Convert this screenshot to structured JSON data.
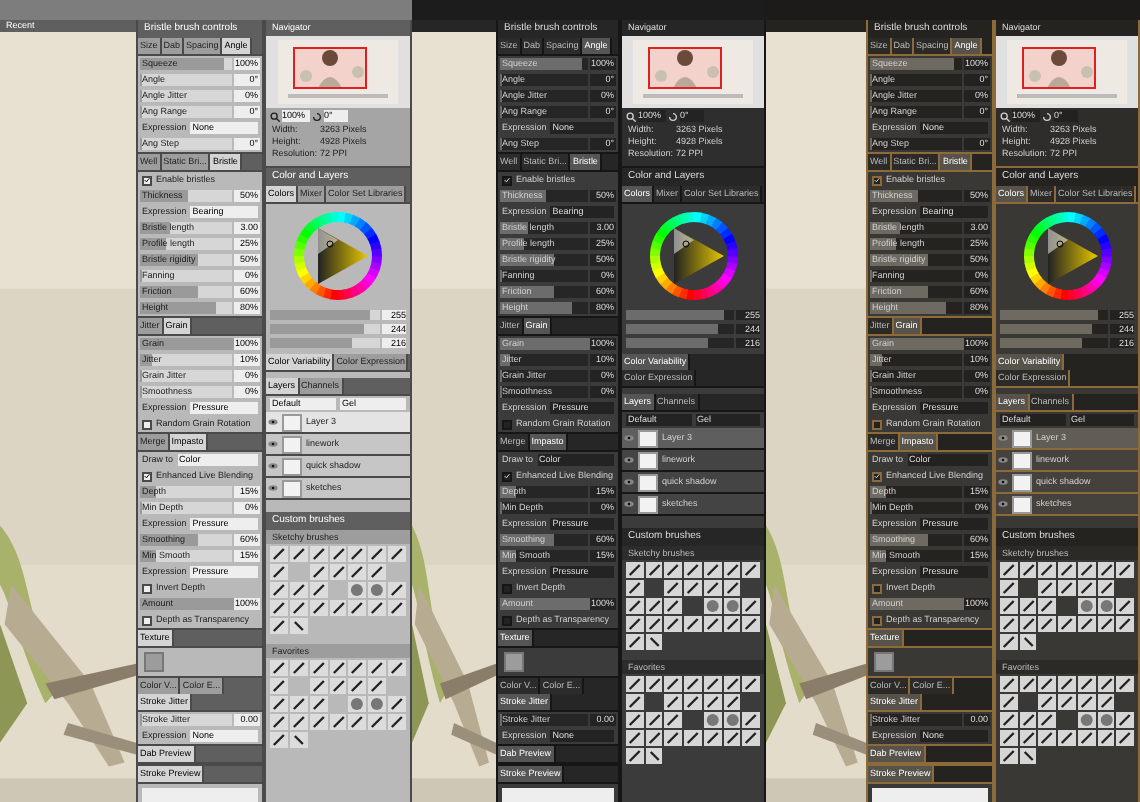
{
  "columns": [
    {
      "kind": "light",
      "canvas": {
        "title": "Recent"
      },
      "brush_panel": {
        "title": "Bristle brush controls",
        "sections": [
          {
            "tabs": [
              {
                "label": "Size",
                "selected": false
              },
              {
                "label": "Dab",
                "selected": false
              },
              {
                "label": "Spacing",
                "selected": false
              },
              {
                "label": "Angle",
                "selected": true
              }
            ],
            "rows": [
              {
                "kind": "slider",
                "label": "Squeeze",
                "reading": "100%",
                "level": 0.9
              },
              {
                "kind": "slider",
                "label": "Angle",
                "reading": "0°",
                "level": 0
              },
              {
                "kind": "slider",
                "label": "Angle Jitter",
                "reading": "0%",
                "level": 0
              },
              {
                "kind": "slider",
                "label": "Ang Range",
                "reading": "0°",
                "level": 0
              },
              {
                "kind": "select",
                "label": "Expression",
                "value": "None"
              },
              {
                "kind": "slider",
                "label": "Ang Step",
                "reading": "0°",
                "level": 0
              }
            ]
          },
          {
            "tabs": [
              {
                "label": "Well",
                "selected": false
              },
              {
                "label": "Static Bri...",
                "selected": false
              },
              {
                "label": "Bristle",
                "selected": true
              }
            ],
            "rows": [
              {
                "kind": "check",
                "label": "Enable bristles",
                "checked": true
              },
              {
                "kind": "slider",
                "label": "Thickness",
                "reading": "50%",
                "level": 0.5
              },
              {
                "kind": "select",
                "label": "Expression",
                "value": "Bearing"
              },
              {
                "kind": "slider",
                "label": "Bristle length",
                "reading": "3.00",
                "level": 0.3
              },
              {
                "kind": "slider",
                "label": "Profile length",
                "reading": "25%",
                "level": 0.25
              },
              {
                "kind": "slider",
                "label": "Bristle rigidity",
                "reading": "50%",
                "level": 0.6
              },
              {
                "kind": "slider",
                "label": "Fanning",
                "reading": "0%",
                "level": 0
              },
              {
                "kind": "slider",
                "label": "Friction",
                "reading": "60%",
                "level": 0.6
              },
              {
                "kind": "slider",
                "label": "Height",
                "reading": "80%",
                "level": 0.8
              }
            ]
          },
          {
            "tabs": [
              {
                "label": "Jitter",
                "selected": false
              },
              {
                "label": "Grain",
                "selected": true
              }
            ],
            "rows": [
              {
                "kind": "slider",
                "label": "Grain",
                "reading": "100%",
                "level": 1
              },
              {
                "kind": "slider",
                "label": "Jitter",
                "reading": "10%",
                "level": 0.1
              },
              {
                "kind": "slider",
                "label": "Grain Jitter",
                "reading": "0%",
                "level": 0
              },
              {
                "kind": "slider",
                "label": "Smoothness",
                "reading": "0%",
                "level": 0
              },
              {
                "kind": "select",
                "label": "Expression",
                "value": "Pressure"
              },
              {
                "kind": "check",
                "label": "Random Grain Rotation",
                "checked": false
              }
            ]
          },
          {
            "tabs": [
              {
                "label": "Merge",
                "selected": false
              },
              {
                "label": "Impasto",
                "selected": true
              }
            ],
            "rows": [
              {
                "kind": "select",
                "label": "Draw to",
                "value": "Color"
              },
              {
                "kind": "check",
                "label": "Enhanced Live Blending",
                "checked": true
              },
              {
                "kind": "slider",
                "label": "Depth",
                "reading": "15%",
                "level": 0.15
              },
              {
                "kind": "slider",
                "label": "Min Depth",
                "reading": "0%",
                "level": 0
              },
              {
                "kind": "select",
                "label": "Expression",
                "value": "Pressure"
              },
              {
                "kind": "slider",
                "label": "Smoothing",
                "reading": "60%",
                "level": 0.6
              },
              {
                "kind": "slider",
                "label": "Min Smooth",
                "reading": "15%",
                "level": 0.15
              },
              {
                "kind": "select",
                "label": "Expression",
                "value": "Pressure"
              },
              {
                "kind": "check",
                "label": "Invert Depth",
                "checked": false
              },
              {
                "kind": "slider",
                "label": "Amount",
                "reading": "100%",
                "level": 1
              },
              {
                "kind": "check",
                "label": "Depth as Transparency",
                "checked": false
              }
            ]
          },
          {
            "tabs": [
              {
                "label": "Texture",
                "selected": true
              }
            ],
            "rows": [
              {
                "kind": "swatch"
              }
            ]
          },
          {
            "tabs": [
              {
                "label": "Color V...",
                "selected": false
              },
              {
                "label": "Color E...",
                "selected": false
              },
              {
                "label": "Stroke Jitter",
                "selected": true
              }
            ],
            "rows": [
              {
                "kind": "slider",
                "label": "Stroke Jitter",
                "reading": "0.00",
                "level": 0
              },
              {
                "kind": "select",
                "label": "Expression",
                "value": "None"
              }
            ]
          },
          {
            "tabs": [
              {
                "label": "Dab Preview",
                "selected": true
              }
            ]
          },
          {
            "tabs": [
              {
                "label": "Stroke Preview",
                "selected": true
              }
            ],
            "rows": [
              {
                "kind": "preview"
              }
            ]
          }
        ]
      },
      "right_panel": {
        "navigator": {
          "title": "Navigator",
          "zoom": "100%",
          "angle": "0°",
          "info": [
            {
              "label": "Width:",
              "value": "3263 Pixels"
            },
            {
              "label": "Height:",
              "value": "4928 Pixels"
            },
            {
              "label": "Resolution:",
              "value": "72 PPI"
            }
          ]
        },
        "color": {
          "title": "Color and Layers",
          "tabs": [
            {
              "label": "Colors",
              "selected": true
            },
            {
              "label": "Mixer",
              "selected": false
            },
            {
              "label": "Color Set Libraries",
              "selected": false
            }
          ],
          "sliders": [
            {
              "reading": "255",
              "level": 0.9
            },
            {
              "reading": "244",
              "level": 0.85
            },
            {
              "reading": "216",
              "level": 0.75
            }
          ],
          "subtabs": [
            {
              "label": "Color Variability",
              "selected": true
            },
            {
              "label": "Color Expression",
              "selected": false
            }
          ]
        },
        "layers": {
          "tabs": [
            {
              "label": "Layers",
              "selected": true
            },
            {
              "label": "Channels",
              "selected": false
            }
          ],
          "blend": "Default",
          "method": "Gel",
          "items": [
            {
              "name": "Layer 3",
              "selected": true
            },
            {
              "name": "linework",
              "selected": false
            },
            {
              "name": "quick shadow",
              "selected": false
            },
            {
              "name": "sketches",
              "selected": false
            }
          ]
        },
        "brushes": {
          "title": "Custom brushes",
          "groups": [
            {
              "title": "Sketchy brushes"
            },
            {
              "title": "Favorites"
            }
          ]
        }
      }
    },
    {
      "kind": "dark",
      "brush_panel": {
        "title": "Bristle brush controls",
        "sections": [
          {
            "tabs": [
              {
                "label": "Size",
                "selected": false
              },
              {
                "label": "Dab",
                "selected": false
              },
              {
                "label": "Spacing",
                "selected": false
              },
              {
                "label": "Angle",
                "selected": true
              }
            ],
            "rows": [
              {
                "kind": "slider",
                "label": "Squeeze",
                "reading": "100%",
                "level": 0.9
              },
              {
                "kind": "slider",
                "label": "Angle",
                "reading": "0°",
                "level": 0
              },
              {
                "kind": "slider",
                "label": "Angle Jitter",
                "reading": "0%",
                "level": 0
              },
              {
                "kind": "slider",
                "label": "Ang Range",
                "reading": "0°",
                "level": 0
              },
              {
                "kind": "select",
                "label": "Expression",
                "value": "None"
              },
              {
                "kind": "slider",
                "label": "Ang Step",
                "reading": "0°",
                "level": 0
              }
            ]
          },
          {
            "tabs": [
              {
                "label": "Well",
                "selected": false
              },
              {
                "label": "Static Bri...",
                "selected": false
              },
              {
                "label": "Bristle",
                "selected": true
              }
            ],
            "rows": [
              {
                "kind": "check",
                "label": "Enable bristles",
                "checked": true
              },
              {
                "kind": "slider",
                "label": "Thickness",
                "reading": "50%",
                "level": 0.5
              },
              {
                "kind": "select",
                "label": "Expression",
                "value": "Bearing"
              },
              {
                "kind": "slider",
                "label": "Bristle length",
                "reading": "3.00",
                "level": 0.3
              },
              {
                "kind": "slider",
                "label": "Profile length",
                "reading": "25%",
                "level": 0.25
              },
              {
                "kind": "slider",
                "label": "Bristle rigidity",
                "reading": "50%",
                "level": 0.6
              },
              {
                "kind": "slider",
                "label": "Fanning",
                "reading": "0%",
                "level": 0
              },
              {
                "kind": "slider",
                "label": "Friction",
                "reading": "60%",
                "level": 0.6
              },
              {
                "kind": "slider",
                "label": "Height",
                "reading": "80%",
                "level": 0.8
              }
            ]
          },
          {
            "tabs": [
              {
                "label": "Jitter",
                "selected": false
              },
              {
                "label": "Grain",
                "selected": true
              }
            ],
            "rows": [
              {
                "kind": "slider",
                "label": "Grain",
                "reading": "100%",
                "level": 1
              },
              {
                "kind": "slider",
                "label": "Jitter",
                "reading": "10%",
                "level": 0.1
              },
              {
                "kind": "slider",
                "label": "Grain Jitter",
                "reading": "0%",
                "level": 0
              },
              {
                "kind": "slider",
                "label": "Smoothness",
                "reading": "0%",
                "level": 0
              },
              {
                "kind": "select",
                "label": "Expression",
                "value": "Pressure"
              },
              {
                "kind": "check",
                "label": "Random Grain Rotation",
                "checked": false
              }
            ]
          },
          {
            "tabs": [
              {
                "label": "Merge",
                "selected": false
              },
              {
                "label": "Impasto",
                "selected": true
              }
            ],
            "rows": [
              {
                "kind": "select",
                "label": "Draw to",
                "value": "Color"
              },
              {
                "kind": "check",
                "label": "Enhanced Live Blending",
                "checked": true
              },
              {
                "kind": "slider",
                "label": "Depth",
                "reading": "15%",
                "level": 0.15
              },
              {
                "kind": "slider",
                "label": "Min Depth",
                "reading": "0%",
                "level": 0
              },
              {
                "kind": "select",
                "label": "Expression",
                "value": "Pressure"
              },
              {
                "kind": "slider",
                "label": "Smoothing",
                "reading": "60%",
                "level": 0.6
              },
              {
                "kind": "slider",
                "label": "Min Smooth",
                "reading": "15%",
                "level": 0.15
              },
              {
                "kind": "select",
                "label": "Expression",
                "value": "Pressure"
              },
              {
                "kind": "check",
                "label": "Invert Depth",
                "checked": false
              },
              {
                "kind": "slider",
                "label": "Amount",
                "reading": "100%",
                "level": 1
              },
              {
                "kind": "check",
                "label": "Depth as Transparency",
                "checked": false
              }
            ]
          },
          {
            "tabs": [
              {
                "label": "Texture",
                "selected": true
              }
            ],
            "rows": [
              {
                "kind": "swatch"
              }
            ]
          },
          {
            "tabs": [
              {
                "label": "Color V...",
                "selected": false
              },
              {
                "label": "Color E...",
                "selected": false
              },
              {
                "label": "Stroke Jitter",
                "selected": true
              }
            ],
            "rows": [
              {
                "kind": "slider",
                "label": "Stroke Jitter",
                "reading": "0.00",
                "level": 0
              },
              {
                "kind": "select",
                "label": "Expression",
                "value": "None"
              }
            ]
          },
          {
            "tabs": [
              {
                "label": "Dab Preview",
                "selected": true
              }
            ]
          },
          {
            "tabs": [
              {
                "label": "Stroke Preview",
                "selected": true
              }
            ],
            "rows": [
              {
                "kind": "preview"
              }
            ]
          }
        ]
      },
      "right_panel": {
        "navigator": {
          "title": "Navigator",
          "zoom": "100%",
          "angle": "0°",
          "info": [
            {
              "label": "Width:",
              "value": "3263 Pixels"
            },
            {
              "label": "Height:",
              "value": "4928 Pixels"
            },
            {
              "label": "Resolution:",
              "value": "72 PPI"
            }
          ]
        },
        "color": {
          "title": "Color and Layers",
          "tabs": [
            {
              "label": "Colors",
              "selected": true
            },
            {
              "label": "Mixer",
              "selected": false
            },
            {
              "label": "Color Set Libraries",
              "selected": false
            }
          ],
          "sliders": [
            {
              "reading": "255",
              "level": 0.9
            },
            {
              "reading": "244",
              "level": 0.85
            },
            {
              "reading": "216",
              "level": 0.75
            }
          ],
          "subtabs": [
            {
              "label": "Color Variability",
              "selected": true
            },
            {
              "label": "Color Expression",
              "selected": false
            }
          ]
        },
        "layers": {
          "tabs": [
            {
              "label": "Layers",
              "selected": true
            },
            {
              "label": "Channels",
              "selected": false
            }
          ],
          "blend": "Default",
          "method": "Gel",
          "items": [
            {
              "name": "Layer 3",
              "selected": true
            },
            {
              "name": "linework",
              "selected": false
            },
            {
              "name": "quick shadow",
              "selected": false
            },
            {
              "name": "sketches",
              "selected": false
            }
          ]
        },
        "brushes": {
          "title": "Custom brushes",
          "groups": [
            {
              "title": "Sketchy brushes"
            },
            {
              "title": "Favorites"
            }
          ]
        }
      }
    },
    {
      "kind": "amber",
      "brush_panel": {
        "title": "Bristle brush controls",
        "sections": [
          {
            "tabs": [
              {
                "label": "Size",
                "selected": false
              },
              {
                "label": "Dab",
                "selected": false
              },
              {
                "label": "Spacing",
                "selected": false
              },
              {
                "label": "Angle",
                "selected": true
              }
            ],
            "rows": [
              {
                "kind": "slider",
                "label": "Squeeze",
                "reading": "100%",
                "level": 0.9
              },
              {
                "kind": "slider",
                "label": "Angle",
                "reading": "0°",
                "level": 0
              },
              {
                "kind": "slider",
                "label": "Angle Jitter",
                "reading": "0%",
                "level": 0
              },
              {
                "kind": "slider",
                "label": "Ang Range",
                "reading": "0°",
                "level": 0
              },
              {
                "kind": "select",
                "label": "Expression",
                "value": "None"
              },
              {
                "kind": "slider",
                "label": "Ang Step",
                "reading": "0°",
                "level": 0
              }
            ]
          },
          {
            "tabs": [
              {
                "label": "Well",
                "selected": false
              },
              {
                "label": "Static Bri...",
                "selected": false
              },
              {
                "label": "Bristle",
                "selected": true
              }
            ],
            "rows": [
              {
                "kind": "check",
                "label": "Enable bristles",
                "checked": true
              },
              {
                "kind": "slider",
                "label": "Thickness",
                "reading": "50%",
                "level": 0.5
              },
              {
                "kind": "select",
                "label": "Expression",
                "value": "Bearing"
              },
              {
                "kind": "slider",
                "label": "Bristle length",
                "reading": "3.00",
                "level": 0.3
              },
              {
                "kind": "slider",
                "label": "Profile length",
                "reading": "25%",
                "level": 0.25
              },
              {
                "kind": "slider",
                "label": "Bristle rigidity",
                "reading": "50%",
                "level": 0.6
              },
              {
                "kind": "slider",
                "label": "Fanning",
                "reading": "0%",
                "level": 0
              },
              {
                "kind": "slider",
                "label": "Friction",
                "reading": "60%",
                "level": 0.6
              },
              {
                "kind": "slider",
                "label": "Height",
                "reading": "80%",
                "level": 0.8
              }
            ]
          },
          {
            "tabs": [
              {
                "label": "Jitter",
                "selected": false
              },
              {
                "label": "Grain",
                "selected": true
              }
            ],
            "rows": [
              {
                "kind": "slider",
                "label": "Grain",
                "reading": "100%",
                "level": 1
              },
              {
                "kind": "slider",
                "label": "Jitter",
                "reading": "10%",
                "level": 0.1
              },
              {
                "kind": "slider",
                "label": "Grain Jitter",
                "reading": "0%",
                "level": 0
              },
              {
                "kind": "slider",
                "label": "Smoothness",
                "reading": "0%",
                "level": 0
              },
              {
                "kind": "select",
                "label": "Expression",
                "value": "Pressure"
              },
              {
                "kind": "check",
                "label": "Random Grain Rotation",
                "checked": false
              }
            ]
          },
          {
            "tabs": [
              {
                "label": "Merge",
                "selected": false
              },
              {
                "label": "Impasto",
                "selected": true
              }
            ],
            "rows": [
              {
                "kind": "select",
                "label": "Draw to",
                "value": "Color"
              },
              {
                "kind": "check",
                "label": "Enhanced Live Blending",
                "checked": true
              },
              {
                "kind": "slider",
                "label": "Depth",
                "reading": "15%",
                "level": 0.15
              },
              {
                "kind": "slider",
                "label": "Min Depth",
                "reading": "0%",
                "level": 0
              },
              {
                "kind": "select",
                "label": "Expression",
                "value": "Pressure"
              },
              {
                "kind": "slider",
                "label": "Smoothing",
                "reading": "60%",
                "level": 0.6
              },
              {
                "kind": "slider",
                "label": "Min Smooth",
                "reading": "15%",
                "level": 0.15
              },
              {
                "kind": "select",
                "label": "Expression",
                "value": "Pressure"
              },
              {
                "kind": "check",
                "label": "Invert Depth",
                "checked": false
              },
              {
                "kind": "slider",
                "label": "Amount",
                "reading": "100%",
                "level": 1
              },
              {
                "kind": "check",
                "label": "Depth as Transparency",
                "checked": false
              }
            ]
          },
          {
            "tabs": [
              {
                "label": "Texture",
                "selected": true
              }
            ],
            "rows": [
              {
                "kind": "swatch"
              }
            ]
          },
          {
            "tabs": [
              {
                "label": "Color V...",
                "selected": false
              },
              {
                "label": "Color E...",
                "selected": false
              },
              {
                "label": "Stroke Jitter",
                "selected": true
              }
            ],
            "rows": [
              {
                "kind": "slider",
                "label": "Stroke Jitter",
                "reading": "0.00",
                "level": 0
              },
              {
                "kind": "select",
                "label": "Expression",
                "value": "None"
              }
            ]
          },
          {
            "tabs": [
              {
                "label": "Dab Preview",
                "selected": true
              }
            ]
          },
          {
            "tabs": [
              {
                "label": "Stroke Preview",
                "selected": true
              }
            ],
            "rows": [
              {
                "kind": "preview"
              }
            ]
          }
        ]
      },
      "right_panel": {
        "navigator": {
          "title": "Navigator",
          "zoom": "100%",
          "angle": "0°",
          "info": [
            {
              "label": "Width:",
              "value": "3263 Pixels"
            },
            {
              "label": "Height:",
              "value": "4928 Pixels"
            },
            {
              "label": "Resolution:",
              "value": "72 PPI"
            }
          ]
        },
        "color": {
          "title": "Color and Layers",
          "tabs": [
            {
              "label": "Colors",
              "selected": true
            },
            {
              "label": "Mixer",
              "selected": false
            },
            {
              "label": "Color Set Libraries",
              "selected": false
            }
          ],
          "sliders": [
            {
              "reading": "255",
              "level": 0.9
            },
            {
              "reading": "244",
              "level": 0.85
            },
            {
              "reading": "216",
              "level": 0.75
            }
          ],
          "subtabs": [
            {
              "label": "Color Variability",
              "selected": true
            },
            {
              "label": "Color Expression",
              "selected": false
            }
          ]
        },
        "layers": {
          "tabs": [
            {
              "label": "Layers",
              "selected": true
            },
            {
              "label": "Channels",
              "selected": false
            }
          ],
          "blend": "Default",
          "method": "Gel",
          "items": [
            {
              "name": "Layer 3",
              "selected": true
            },
            {
              "name": "linework",
              "selected": false
            },
            {
              "name": "quick shadow",
              "selected": false
            },
            {
              "name": "sketches",
              "selected": false
            }
          ]
        },
        "brushes": {
          "title": "Custom brushes",
          "groups": [
            {
              "title": "Sketchy brushes"
            },
            {
              "title": "Favorites"
            }
          ]
        }
      }
    }
  ]
}
